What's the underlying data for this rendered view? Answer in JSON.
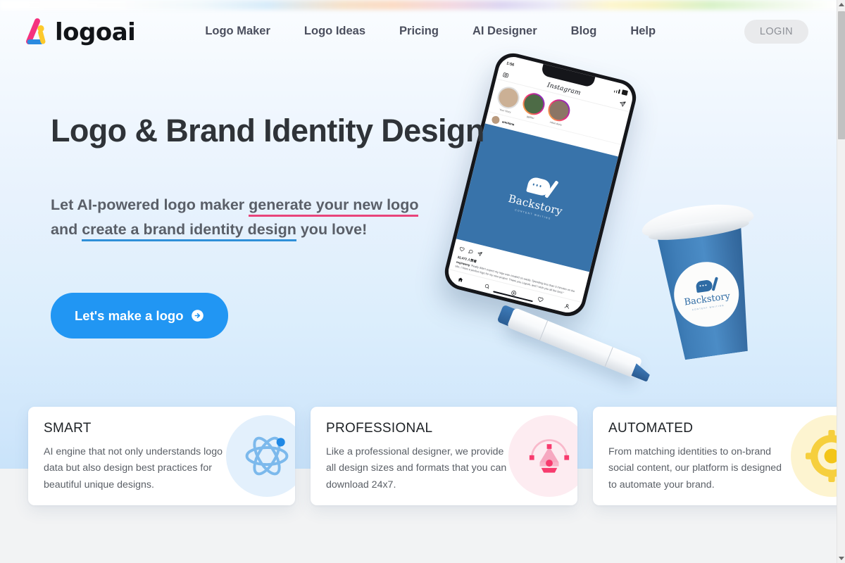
{
  "header": {
    "brand_word": "logoai",
    "logo_icon": "logoai-a-mark",
    "nav": [
      {
        "label": "Logo Maker"
      },
      {
        "label": "Logo Ideas"
      },
      {
        "label": "Pricing"
      },
      {
        "label": "AI Designer"
      },
      {
        "label": "Blog"
      },
      {
        "label": "Help"
      }
    ],
    "login_label": "LOGIN"
  },
  "hero": {
    "title": "Logo & Brand Identity Design",
    "sub_part1": "Let AI-powered logo maker ",
    "sub_highlight_pink": "generate your new logo",
    "sub_part2": " and ",
    "sub_highlight_blue": "create a brand identity design",
    "sub_part3": " you love!",
    "cta_label": "Let's make a logo",
    "cta_icon": "arrow-right-circle-icon"
  },
  "mockup": {
    "phone": {
      "status_time": "1:56",
      "app_name": "Instagram",
      "stories": [
        {
          "name": "Your Story"
        },
        {
          "name": "ggdlau"
        },
        {
          "name": "mikel.daria"
        }
      ],
      "post_account": "amolana",
      "brand_name": "Backstory",
      "brand_tagline": "CONTENT WRITING",
      "likes": "32,473 人赞看",
      "caption_user": "enginpang",
      "caption_text": "\"Really didn't expect my logo was created so easily. Spending less than 5 minutes on the site, I have a perfect logo for my new project. Thank you LogoAi, and I wish you all the best.\""
    },
    "cup": {
      "brand_name": "Backstory",
      "brand_tagline": "CONTENT WRITING"
    },
    "marker": {
      "label": "marker-pen"
    }
  },
  "features": [
    {
      "title": "SMART",
      "body": "AI engine that not only understands logo data but also design best practices for beautiful unique designs.",
      "icon": "atom-icon",
      "icon_bg": "#e3f0fc",
      "icon_color": "#7cb9ec",
      "accent_color": "#1f88e5"
    },
    {
      "title": "PROFESSIONAL",
      "body": "Like a professional designer, we provide all design sizes and formats that you can download 24x7.",
      "icon": "pen-tool-icon",
      "icon_bg": "#fdecf1",
      "icon_color": "#f5a6bd",
      "accent_color": "#f73b6e"
    },
    {
      "title": "AUTOMATED",
      "body": "From matching identities to on-brand social content, our platform is designed to automate your brand.",
      "icon": "gear-automation-icon",
      "icon_bg": "#fdf4d0",
      "icon_color": "#f6cf3e",
      "accent_color": "#f3c518"
    }
  ],
  "colors": {
    "primary_blue": "#2196f3",
    "underline_pink": "#e8447b",
    "underline_blue": "#2f8fd8",
    "logo_pink": "#f5327e",
    "logo_blue": "#2b8ae0",
    "logo_yellow": "#fdc92b",
    "heading": "#2f3338",
    "body_text": "#5b6067",
    "hero_bg_top": "#fbfdff",
    "hero_bg_bottom": "#c9e3fa",
    "below_bg": "#f2f3f4"
  },
  "scrollbar": {
    "position": "top",
    "orientation": "vertical"
  }
}
